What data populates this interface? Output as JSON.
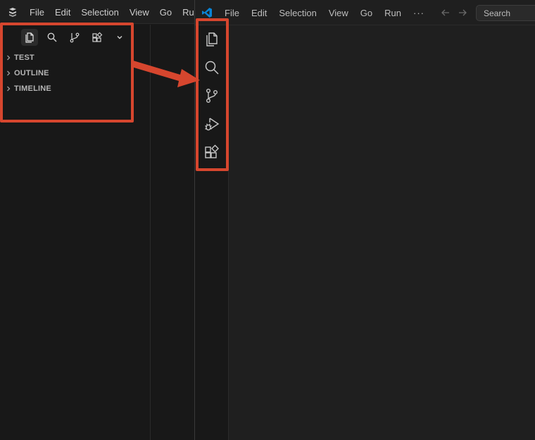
{
  "left_window": {
    "menu": [
      "File",
      "Edit",
      "Selection",
      "View",
      "Go",
      "Ru"
    ],
    "view_icons": [
      "explorer-icon",
      "search-icon",
      "source-control-icon",
      "extensions-icon",
      "chevron-down-icon"
    ],
    "sections": [
      {
        "label": "TEST"
      },
      {
        "label": "OUTLINE"
      },
      {
        "label": "TIMELINE"
      }
    ]
  },
  "right_window": {
    "menu": [
      "File",
      "Edit",
      "Selection",
      "View",
      "Go",
      "Run"
    ],
    "more_label": "···",
    "search_label": "Search",
    "activity_icons": [
      "explorer-icon",
      "search-icon",
      "source-control-icon",
      "run-debug-icon",
      "extensions-icon"
    ]
  },
  "colors": {
    "highlight": "#d6462e",
    "background": "#181818",
    "titlebar": "#1f1f1f",
    "vscode_blue": "#0a84d6"
  }
}
